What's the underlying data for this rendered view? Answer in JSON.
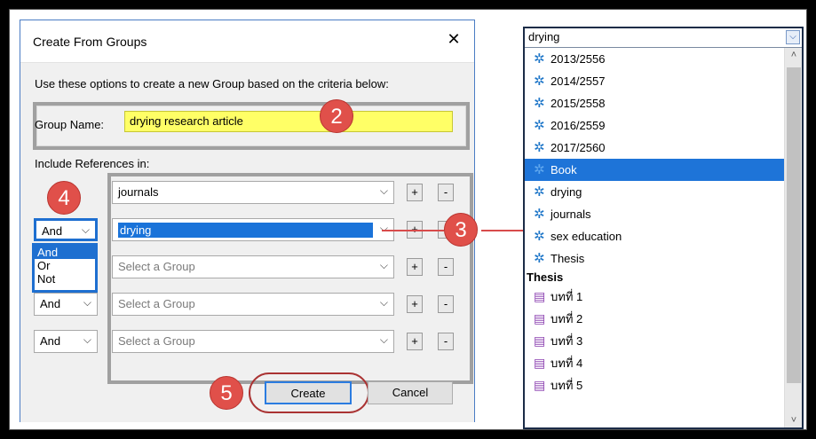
{
  "dialog": {
    "title": "Create From Groups",
    "close_glyph": "✕",
    "instruction": "Use these options to create a new Group based on the criteria below:",
    "group_name_label": "Group Name:",
    "group_name_value": "drying research article",
    "include_label": "Include References in:",
    "rows": [
      {
        "group": "journals",
        "placeholder": false
      },
      {
        "group": "drying",
        "placeholder": false
      },
      {
        "group": "Select a Group",
        "placeholder": true
      },
      {
        "group": "Select a Group",
        "placeholder": true
      },
      {
        "group": "Select a Group",
        "placeholder": true
      }
    ],
    "operators": [
      "And",
      "And",
      "And",
      "And"
    ],
    "operator_options": [
      "And",
      "Or",
      "Not"
    ],
    "plus": "+",
    "minus": "-",
    "chevron": "⌵",
    "create_label": "Create",
    "cancel_label": "Cancel"
  },
  "badges": [
    "2",
    "3",
    "4",
    "5"
  ],
  "right_panel": {
    "search_value": "drying",
    "items": [
      {
        "label": "2013/2556",
        "icon": "gear-icon"
      },
      {
        "label": "2014/2557",
        "icon": "gear-icon"
      },
      {
        "label": "2015/2558",
        "icon": "gear-icon"
      },
      {
        "label": "2016/2559",
        "icon": "gear-icon"
      },
      {
        "label": "2017/2560",
        "icon": "gear-icon"
      },
      {
        "label": "Book",
        "icon": "gear-icon",
        "selected": true
      },
      {
        "label": "drying",
        "icon": "gear-icon"
      },
      {
        "label": "journals",
        "icon": "gear-icon"
      },
      {
        "label": "sex education",
        "icon": "gear-icon"
      },
      {
        "label": "Thesis",
        "icon": "gear-icon"
      }
    ],
    "section_header": "Thesis",
    "sub_items": [
      "บทที่ 1",
      "บทที่ 2",
      "บทที่ 3",
      "บทที่ 4",
      "บทที่ 5"
    ]
  },
  "colors": {
    "highlight_yellow": "#ffff66",
    "selection_blue": "#1e74d8",
    "badge_red": "#e0504a"
  }
}
